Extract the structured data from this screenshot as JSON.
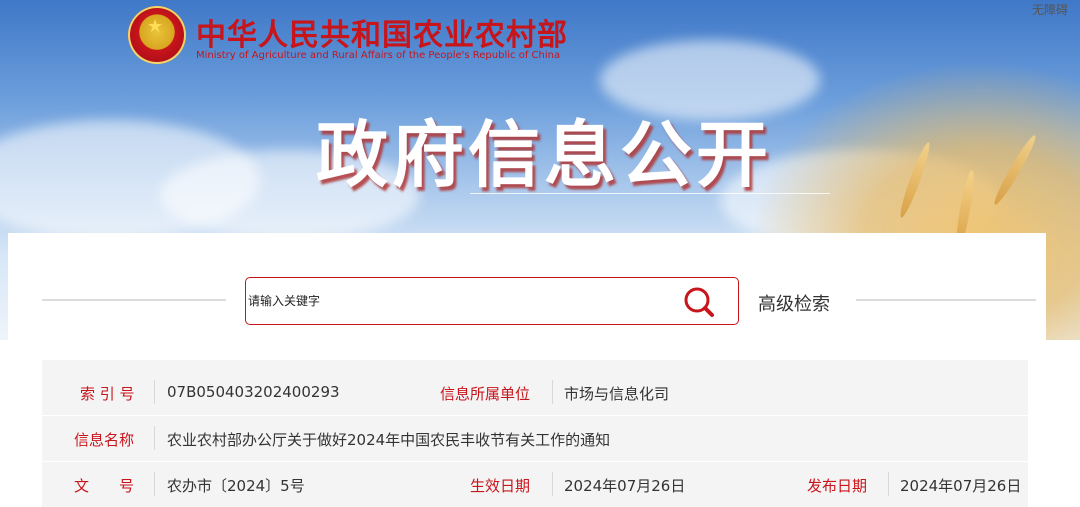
{
  "header": {
    "ministry_cn": "中华人民共和国农业农村部",
    "ministry_en": "Ministry of Agriculture and Rural Affairs of the People's Republic of China",
    "accessibility": "无障碍",
    "page_title": "政府信息公开",
    "emblem_icon": "national-emblem-icon"
  },
  "search": {
    "placeholder": "请输入关键字",
    "icon": "search-icon",
    "advanced_label": "高级检索"
  },
  "metadata": {
    "index_label": "索 引 号",
    "index_value": "07B050403202400293",
    "unit_label": "信息所属单位",
    "unit_value": "市场与信息化司",
    "name_label": "信息名称",
    "name_value": "农业农村部办公厅关于做好2024年中国农民丰收节有关工作的通知",
    "doc_no_label": "文　　号",
    "doc_no_value": "农办市〔2024〕5号",
    "effective_label": "生效日期",
    "effective_value": "2024年07月26日",
    "publish_label": "发布日期",
    "publish_value": "2024年07月26日"
  },
  "colors": {
    "accent_red": "#c8141b",
    "table_bg": "#f4f4f4"
  }
}
